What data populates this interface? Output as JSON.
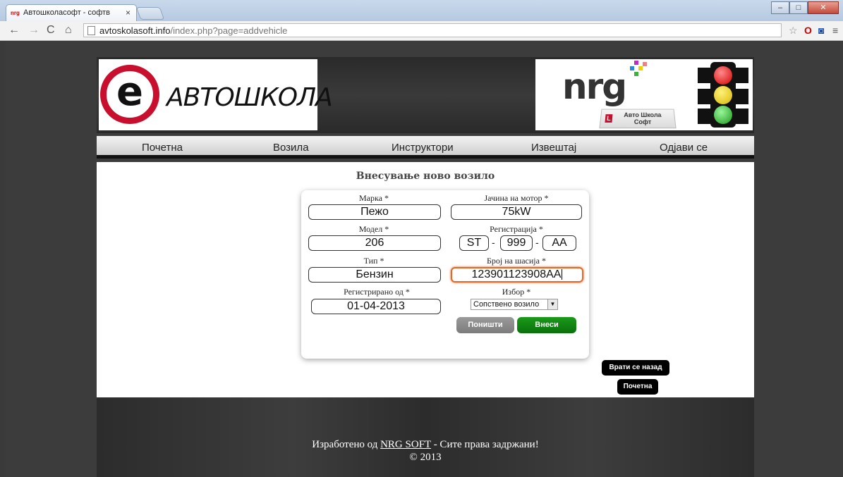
{
  "browser": {
    "tab_title": "Автошколасофт - софтв",
    "tab_close": "×",
    "url_host": "avtoskolasoft.info",
    "url_path": "/index.php?page=addvehicle"
  },
  "header": {
    "logo_letter": "e",
    "logo_text": "АВТОШКОЛА",
    "brand_text": "nrg",
    "badge_text": "Авто Школа Софт"
  },
  "nav": {
    "items": [
      "Почетна",
      "Возила",
      "Инструктори",
      "Извештај",
      "Одјави се"
    ]
  },
  "form": {
    "title": "Внесување ново возило",
    "brand_label": "Марка *",
    "brand_value": "Пежо",
    "engine_label": "Јачина на мотор *",
    "engine_value": "75kW",
    "model_label": "Модел *",
    "model_value": "206",
    "registration_label": "Регистрација *",
    "registration_city": "ST",
    "registration_number": "999",
    "registration_letters": "AA",
    "registration_dash": "-",
    "type_label": "Тип *",
    "type_value": "Бензин",
    "chassis_label": "Број на шасија *",
    "chassis_value": "123901123908AA",
    "registered_label": "Регистрирано од *",
    "registered_value": "01-04-2013",
    "choice_label": "Избор *",
    "choice_value": "Сопствено возило",
    "cancel_label": "Поништи",
    "submit_label": "Внеси"
  },
  "side_buttons": {
    "back_label": "Врати се назад",
    "home_label": "Почетна"
  },
  "footer": {
    "prefix": "Изработено од",
    "link": "NRG SOFT",
    "suffix": "- Сите права задржани!",
    "copyright": "© 2013"
  },
  "colors": {
    "logo_red": "#c8102e",
    "submit_green": "#0b700b",
    "focus_orange": "#e06a2b"
  }
}
